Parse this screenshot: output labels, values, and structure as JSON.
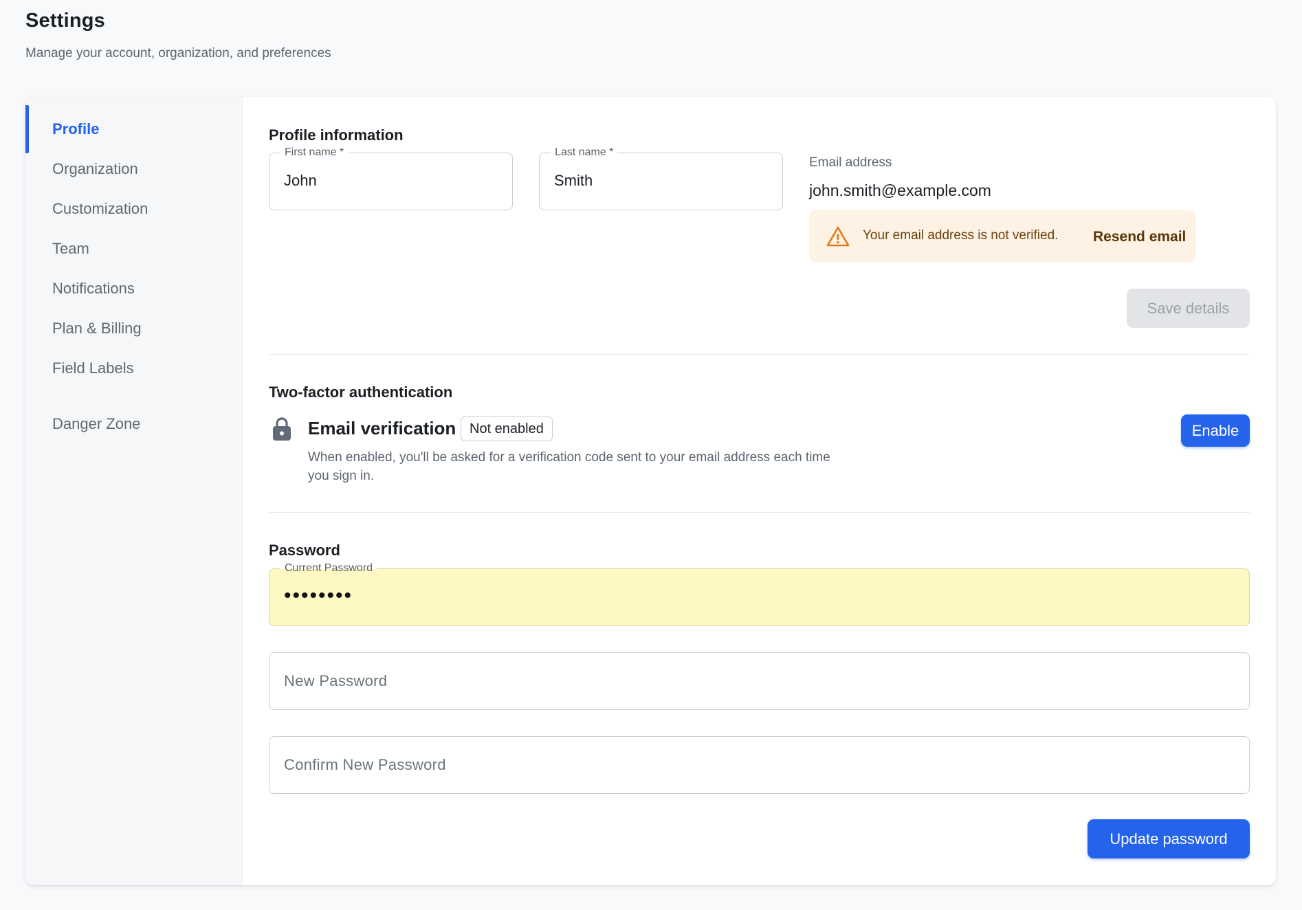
{
  "header": {
    "title": "Settings",
    "subtitle": "Manage your account, organization, and preferences"
  },
  "sidebar": {
    "items": [
      {
        "label": "Profile",
        "active": true
      },
      {
        "label": "Organization"
      },
      {
        "label": "Customization"
      },
      {
        "label": "Team"
      },
      {
        "label": "Notifications"
      },
      {
        "label": "Plan & Billing"
      },
      {
        "label": "Field Labels"
      },
      {
        "label": "Danger Zone"
      }
    ]
  },
  "profile": {
    "title": "Profile information",
    "first_name_label": "First name *",
    "first_name_value": "John",
    "last_name_label": "Last name *",
    "last_name_value": "Smith",
    "email_label": "Email address",
    "email_value": "john.smith@example.com",
    "warning_text": "Your email address is not verified.",
    "warning_icon": "warning-triangle-icon",
    "resend_label": "Resend email",
    "save_label": "Save details"
  },
  "two_factor": {
    "title": "Two-factor authentication",
    "icon": "lock-icon",
    "method_name": "Email verification",
    "status_badge": "Not enabled",
    "description": "When enabled, you'll be asked for a verification code sent to your email address each time you sign in.",
    "enable_label": "Enable"
  },
  "password": {
    "title": "Password",
    "current_label": "Current Password",
    "current_value_masked": "••••••••",
    "new_placeholder": "New Password",
    "confirm_placeholder": "Confirm New Password",
    "update_label": "Update password"
  },
  "colors": {
    "accent": "#2563eb",
    "warning_bg": "#fdf2e4",
    "warning_icon": "#e07b1a",
    "autofill_bg": "#fef9c3"
  }
}
